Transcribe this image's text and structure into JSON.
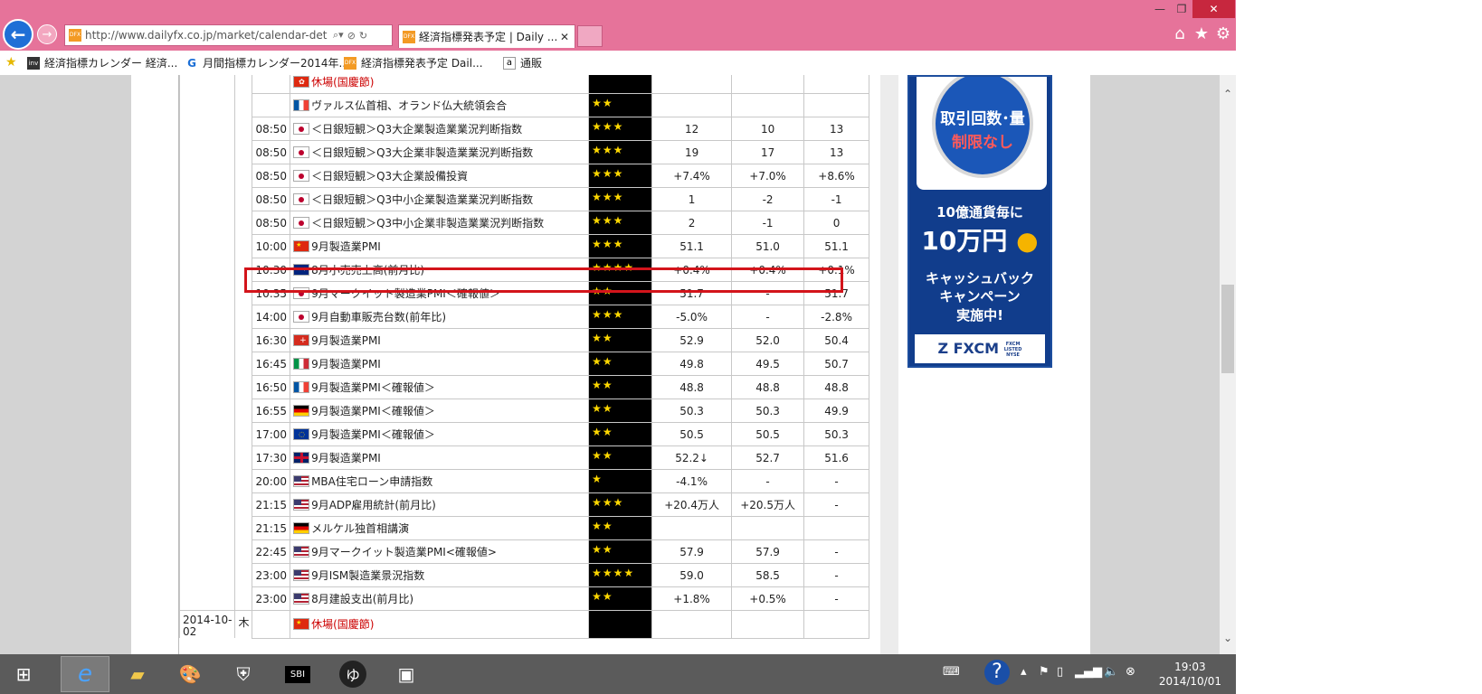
{
  "browser": {
    "url": "http://www.dailyfx.co.jp/market/calendar-det",
    "tab_title": "経済指標発表予定 | Daily ...",
    "favicon_text": "DFX",
    "favorites": [
      {
        "label": "経済指標カレンダー 経済...",
        "icon": "inv"
      },
      {
        "label": "月間指標カレンダー2014年...",
        "icon": "G"
      },
      {
        "label": "経済指標発表予定  Dail...",
        "icon": "DFX"
      },
      {
        "label": "通販",
        "icon": "a"
      }
    ]
  },
  "calendar": {
    "rows": [
      {
        "time": "",
        "flag": "hk",
        "event": "休場(国慶節)",
        "red": true,
        "stars": "",
        "actual": "",
        "forecast": "",
        "previous": ""
      },
      {
        "time": "",
        "flag": "fr",
        "event": "ヴァルス仏首相、オランド仏大統領会合",
        "red": false,
        "stars": "★★",
        "actual": "",
        "forecast": "",
        "previous": ""
      },
      {
        "time": "08:50",
        "flag": "jp",
        "event": "＜日銀短観＞Q3大企業製造業業況判断指数",
        "red": false,
        "stars": "★★★",
        "actual": "12",
        "forecast": "10",
        "previous": "13"
      },
      {
        "time": "08:50",
        "flag": "jp",
        "event": "＜日銀短観＞Q3大企業非製造業業況判断指数",
        "red": false,
        "stars": "★★★",
        "actual": "19",
        "forecast": "17",
        "previous": "13"
      },
      {
        "time": "08:50",
        "flag": "jp",
        "event": "＜日銀短観＞Q3大企業設備投資",
        "red": false,
        "stars": "★★★",
        "actual": "+7.4%",
        "forecast": "+7.0%",
        "previous": "+8.6%"
      },
      {
        "time": "08:50",
        "flag": "jp",
        "event": "＜日銀短観＞Q3中小企業製造業業況判断指数",
        "red": false,
        "stars": "★★★",
        "actual": "1",
        "forecast": "-2",
        "previous": "-1"
      },
      {
        "time": "08:50",
        "flag": "jp",
        "event": "＜日銀短観＞Q3中小企業非製造業業況判断指数",
        "red": false,
        "stars": "★★★",
        "actual": "2",
        "forecast": "-1",
        "previous": "0"
      },
      {
        "time": "10:00",
        "flag": "cn",
        "event": "9月製造業PMI",
        "red": false,
        "stars": "★★★",
        "actual": "51.1",
        "forecast": "51.0",
        "previous": "51.1"
      },
      {
        "time": "10:30",
        "flag": "au",
        "event": "8月小売売上高(前月比)",
        "red": false,
        "stars": "★★★★",
        "actual": "+0.4%",
        "forecast": "+0.4%",
        "previous": "+0.1%"
      },
      {
        "time": "10:35",
        "flag": "jp",
        "event": "9月マークイット製造業PMI＜確報値＞",
        "red": false,
        "stars": "★★",
        "actual": "51.7",
        "forecast": "-",
        "previous": "51.7"
      },
      {
        "time": "14:00",
        "flag": "jp",
        "event": "9月自動車販売台数(前年比)",
        "red": false,
        "stars": "★★★",
        "actual": "-5.0%",
        "forecast": "-",
        "previous": "-2.8%"
      },
      {
        "time": "16:30",
        "flag": "ch",
        "event": "9月製造業PMI",
        "red": false,
        "stars": "★★",
        "actual": "52.9",
        "forecast": "52.0",
        "previous": "50.4"
      },
      {
        "time": "16:45",
        "flag": "it",
        "event": "9月製造業PMI",
        "red": false,
        "stars": "★★",
        "actual": "49.8",
        "forecast": "49.5",
        "previous": "50.7"
      },
      {
        "time": "16:50",
        "flag": "fr",
        "event": "9月製造業PMI＜確報値＞",
        "red": false,
        "stars": "★★",
        "actual": "48.8",
        "forecast": "48.8",
        "previous": "48.8"
      },
      {
        "time": "16:55",
        "flag": "de",
        "event": "9月製造業PMI＜確報値＞",
        "red": false,
        "stars": "★★",
        "actual": "50.3",
        "forecast": "50.3",
        "previous": "49.9"
      },
      {
        "time": "17:00",
        "flag": "eu",
        "event": "9月製造業PMI＜確報値＞",
        "red": false,
        "stars": "★★",
        "actual": "50.5",
        "forecast": "50.5",
        "previous": "50.3"
      },
      {
        "time": "17:30",
        "flag": "gb",
        "event": "9月製造業PMI",
        "red": false,
        "stars": "★★",
        "actual": "52.2↓",
        "forecast": "52.7",
        "previous": "51.6"
      },
      {
        "time": "20:00",
        "flag": "us",
        "event": "MBA住宅ローン申請指数",
        "red": false,
        "stars": "★",
        "actual": "-4.1%",
        "forecast": "-",
        "previous": "-"
      },
      {
        "time": "21:15",
        "flag": "us",
        "event": "9月ADP雇用統計(前月比)",
        "red": false,
        "stars": "★★★",
        "actual": "+20.4万人",
        "forecast": "+20.5万人",
        "previous": "-"
      },
      {
        "time": "21:15",
        "flag": "de",
        "event": "メルケル独首相講演",
        "red": false,
        "stars": "★★",
        "actual": "",
        "forecast": "",
        "previous": ""
      },
      {
        "time": "22:45",
        "flag": "us",
        "event": "9月マークイット製造業PMI<確報値>",
        "red": false,
        "stars": "★★",
        "actual": "57.9",
        "forecast": "57.9",
        "previous": "-"
      },
      {
        "time": "23:00",
        "flag": "us",
        "event": "9月ISM製造業景況指数",
        "red": false,
        "stars": "★★★★",
        "actual": "59.0",
        "forecast": "58.5",
        "previous": "-"
      },
      {
        "time": "23:00",
        "flag": "us",
        "event": "8月建設支出(前月比)",
        "red": false,
        "stars": "★★",
        "actual": "+1.8%",
        "forecast": "+0.5%",
        "previous": "-"
      }
    ],
    "next_day": {
      "date": "2014-10-",
      "date2": "02",
      "dow": "木",
      "flag": "cn",
      "event": "休場(国慶節)"
    }
  },
  "ad": {
    "circle_line1": "取引回数･量",
    "circle_line2": "制限なし",
    "line1": "10億通貨毎に",
    "line2": "10万円",
    "line3": "キャッシュバック",
    "line4": "キャンペーン",
    "line5": "実施中!",
    "footer": "FXCM",
    "footer_small": "FXCM LISTED NYSE"
  },
  "taskbar": {
    "time": "19:03",
    "date": "2014/10/01"
  }
}
